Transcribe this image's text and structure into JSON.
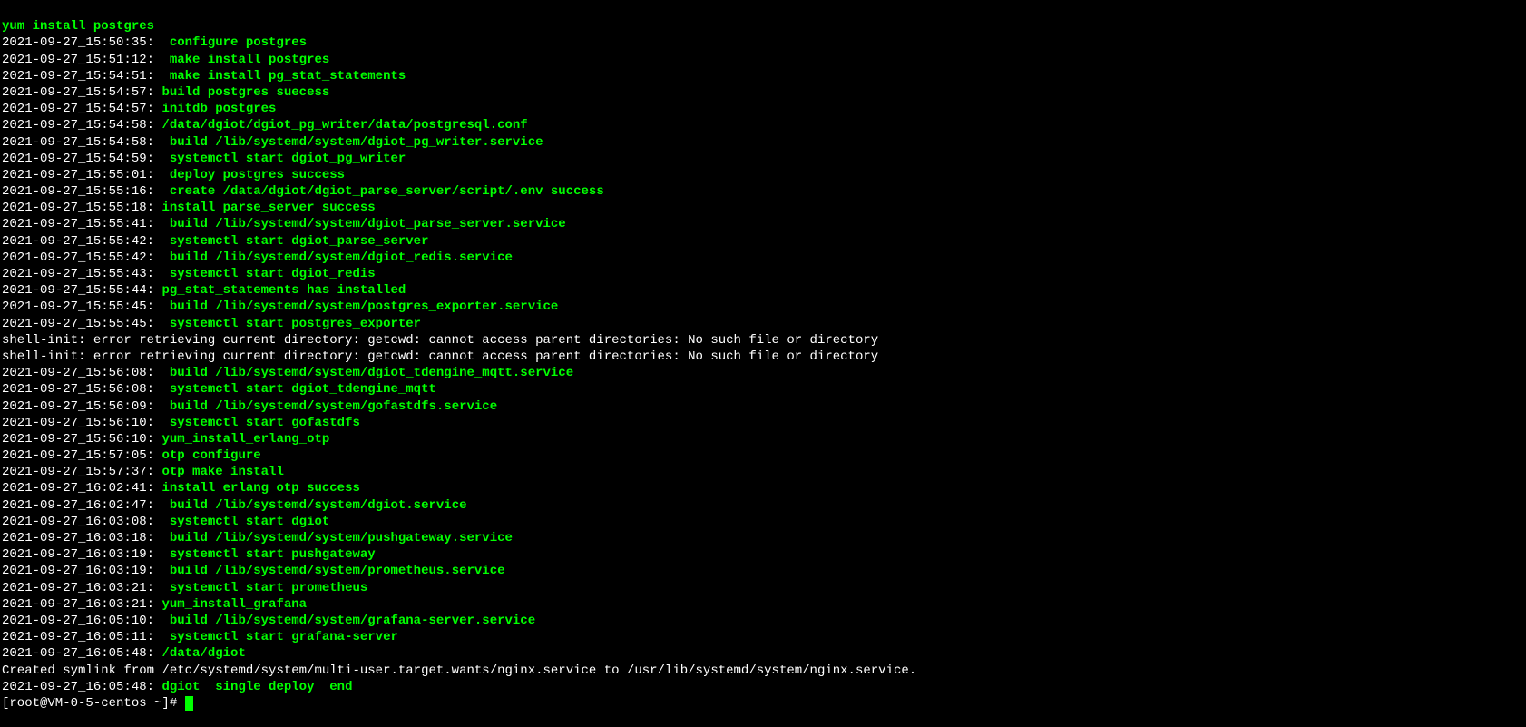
{
  "lines": [
    {
      "type": "green-only",
      "text": "yum install postgres"
    },
    {
      "type": "ts-green",
      "ts": "2021-09-27_15:50:35:",
      "text": " configure postgres"
    },
    {
      "type": "ts-green",
      "ts": "2021-09-27_15:51:12:",
      "text": " make install postgres"
    },
    {
      "type": "ts-green",
      "ts": "2021-09-27_15:54:51:",
      "text": " make install pg_stat_statements"
    },
    {
      "type": "ts-green-nogap",
      "ts": "2021-09-27_15:54:57:",
      "text": "build postgres suecess"
    },
    {
      "type": "ts-green-nogap",
      "ts": "2021-09-27_15:54:57:",
      "text": "initdb postgres"
    },
    {
      "type": "ts-green",
      "ts": "2021-09-27_15:54:58:",
      "text": "/data/dgiot/dgiot_pg_writer/data/postgresql.conf"
    },
    {
      "type": "ts-green",
      "ts": "2021-09-27_15:54:58:",
      "text": " build /lib/systemd/system/dgiot_pg_writer.service"
    },
    {
      "type": "ts-green",
      "ts": "2021-09-27_15:54:59:",
      "text": " systemctl start dgiot_pg_writer"
    },
    {
      "type": "ts-green",
      "ts": "2021-09-27_15:55:01:",
      "text": " deploy postgres success"
    },
    {
      "type": "ts-green",
      "ts": "2021-09-27_15:55:16:",
      "text": " create /data/dgiot/dgiot_parse_server/script/.env success"
    },
    {
      "type": "ts-green-nogap",
      "ts": "2021-09-27_15:55:18:",
      "text": "install parse_server success"
    },
    {
      "type": "ts-green",
      "ts": "2021-09-27_15:55:41:",
      "text": " build /lib/systemd/system/dgiot_parse_server.service"
    },
    {
      "type": "ts-green",
      "ts": "2021-09-27_15:55:42:",
      "text": " systemctl start dgiot_parse_server"
    },
    {
      "type": "ts-green",
      "ts": "2021-09-27_15:55:42:",
      "text": " build /lib/systemd/system/dgiot_redis.service"
    },
    {
      "type": "ts-green",
      "ts": "2021-09-27_15:55:43:",
      "text": " systemctl start dgiot_redis"
    },
    {
      "type": "ts-green-nogap",
      "ts": "2021-09-27_15:55:44:",
      "text": "pg_stat_statements has installed"
    },
    {
      "type": "ts-green",
      "ts": "2021-09-27_15:55:45:",
      "text": " build /lib/systemd/system/postgres_exporter.service"
    },
    {
      "type": "ts-green",
      "ts": "2021-09-27_15:55:45:",
      "text": " systemctl start postgres_exporter"
    },
    {
      "type": "white-only",
      "text": "shell-init: error retrieving current directory: getcwd: cannot access parent directories: No such file or directory"
    },
    {
      "type": "white-only",
      "text": "shell-init: error retrieving current directory: getcwd: cannot access parent directories: No such file or directory"
    },
    {
      "type": "ts-green",
      "ts": "2021-09-27_15:56:08:",
      "text": " build /lib/systemd/system/dgiot_tdengine_mqtt.service"
    },
    {
      "type": "ts-green",
      "ts": "2021-09-27_15:56:08:",
      "text": " systemctl start dgiot_tdengine_mqtt"
    },
    {
      "type": "ts-green",
      "ts": "2021-09-27_15:56:09:",
      "text": " build /lib/systemd/system/gofastdfs.service"
    },
    {
      "type": "ts-green",
      "ts": "2021-09-27_15:56:10:",
      "text": " systemctl start gofastdfs"
    },
    {
      "type": "ts-green-nogap",
      "ts": "2021-09-27_15:56:10:",
      "text": "yum_install_erlang_otp"
    },
    {
      "type": "ts-green-nogap",
      "ts": "2021-09-27_15:57:05:",
      "text": "otp configure"
    },
    {
      "type": "ts-green-nogap",
      "ts": "2021-09-27_15:57:37:",
      "text": "otp make install"
    },
    {
      "type": "ts-green-nogap",
      "ts": "2021-09-27_16:02:41:",
      "text": "install erlang otp success"
    },
    {
      "type": "ts-green",
      "ts": "2021-09-27_16:02:47:",
      "text": " build /lib/systemd/system/dgiot.service"
    },
    {
      "type": "ts-green",
      "ts": "2021-09-27_16:03:08:",
      "text": " systemctl start dgiot"
    },
    {
      "type": "ts-green",
      "ts": "2021-09-27_16:03:18:",
      "text": " build /lib/systemd/system/pushgateway.service"
    },
    {
      "type": "ts-green",
      "ts": "2021-09-27_16:03:19:",
      "text": " systemctl start pushgateway"
    },
    {
      "type": "ts-green",
      "ts": "2021-09-27_16:03:19:",
      "text": " build /lib/systemd/system/prometheus.service"
    },
    {
      "type": "ts-green",
      "ts": "2021-09-27_16:03:21:",
      "text": " systemctl start prometheus"
    },
    {
      "type": "ts-green-nogap",
      "ts": "2021-09-27_16:03:21:",
      "text": "yum_install_grafana"
    },
    {
      "type": "ts-green",
      "ts": "2021-09-27_16:05:10:",
      "text": " build /lib/systemd/system/grafana-server.service"
    },
    {
      "type": "ts-green",
      "ts": "2021-09-27_16:05:11:",
      "text": " systemctl start grafana-server"
    },
    {
      "type": "ts-green-nogap",
      "ts": "2021-09-27_16:05:48:",
      "text": "/data/dgiot"
    },
    {
      "type": "white-only",
      "text": "Created symlink from /etc/systemd/system/multi-user.target.wants/nginx.service to /usr/lib/systemd/system/nginx.service."
    },
    {
      "type": "ts-green-nogap",
      "ts": "2021-09-27_16:05:48:",
      "text": "dgiot  single deploy  end"
    }
  ],
  "prompt": "[root@VM-0-5-centos ~]# "
}
